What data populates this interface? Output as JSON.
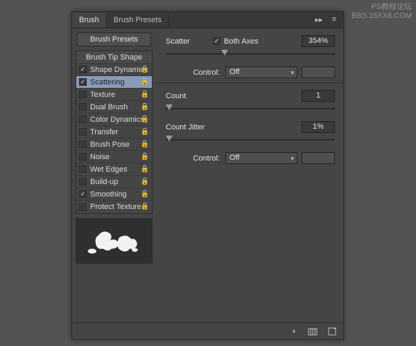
{
  "watermark": {
    "line1": "PS教程论坛",
    "line2": "BBS.16XX8.COM"
  },
  "tabs": {
    "brush": "Brush",
    "presets": "Brush Presets"
  },
  "left": {
    "presetsButton": "Brush Presets",
    "header": "Brush Tip Shape",
    "items": [
      {
        "label": "Shape Dynamics",
        "checked": true,
        "locked": true
      },
      {
        "label": "Scattering",
        "checked": true,
        "locked": true
      },
      {
        "label": "Texture",
        "checked": false,
        "locked": true
      },
      {
        "label": "Dual Brush",
        "checked": false,
        "locked": true
      },
      {
        "label": "Color Dynamics",
        "checked": false,
        "locked": true
      },
      {
        "label": "Transfer",
        "checked": false,
        "locked": true
      },
      {
        "label": "Brush Pose",
        "checked": false,
        "locked": true
      },
      {
        "label": "Noise",
        "checked": false,
        "locked": true
      },
      {
        "label": "Wet Edges",
        "checked": false,
        "locked": true
      },
      {
        "label": "Build-up",
        "checked": false,
        "locked": true
      },
      {
        "label": "Smoothing",
        "checked": true,
        "locked": true
      },
      {
        "label": "Protect Texture",
        "checked": false,
        "locked": true
      }
    ]
  },
  "right": {
    "scatterLabel": "Scatter",
    "bothAxesLabel": "Both Axes",
    "bothAxesChecked": true,
    "scatterValue": "354%",
    "scatterPercent": 35,
    "controlLabel": "Control:",
    "control1Value": "Off",
    "countLabel": "Count",
    "countValue": "1",
    "countPercent": 2,
    "countJitterLabel": "Count Jitter",
    "countJitterValue": "1%",
    "countJitterPercent": 2,
    "control2Value": "Off"
  }
}
